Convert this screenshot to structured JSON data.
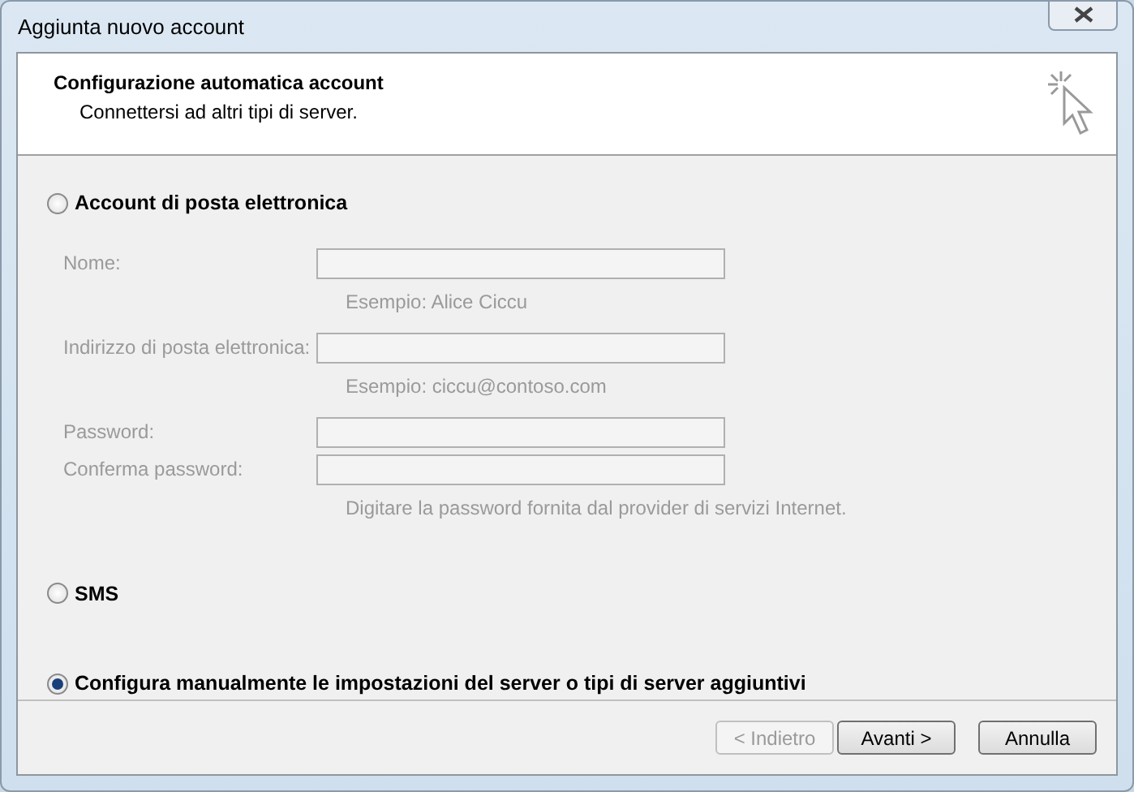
{
  "window": {
    "title": "Aggiunta nuovo account"
  },
  "header": {
    "title": "Configurazione automatica account",
    "subtitle": "Connettersi ad altri tipi di server."
  },
  "options": [
    {
      "kind": "radio",
      "label": "Account di posta elettronica",
      "selected": false,
      "fields": [
        {
          "label": "Nome:",
          "disabled": true,
          "hint": "Esempio: Alice Ciccu"
        },
        {
          "label": "Indirizzo di posta elettronica:",
          "disabled": true,
          "hint": "Esempio: ciccu@contoso.com"
        },
        {
          "label": "Password:",
          "disabled": true
        },
        {
          "label": "Conferma password:",
          "disabled": true,
          "hint": "Digitare la password fornita dal provider di servizi Internet."
        }
      ]
    },
    {
      "kind": "radio",
      "label": "SMS",
      "selected": false
    },
    {
      "kind": "radio",
      "label": "Configura manualmente le impostazioni del server o tipi di server aggiuntivi",
      "selected": true
    }
  ],
  "buttons": [
    {
      "label": "< Indietro",
      "disabled": true
    },
    {
      "label": "Avanti >",
      "disabled": false
    },
    {
      "label": "Annulla",
      "disabled": false
    }
  ]
}
